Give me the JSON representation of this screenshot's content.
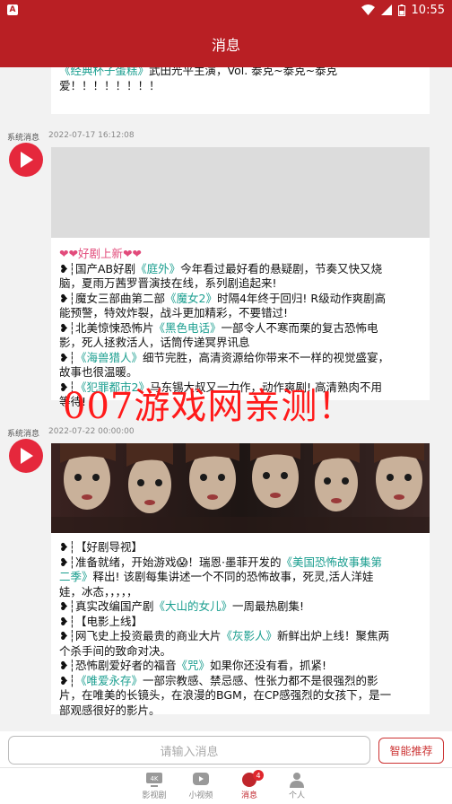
{
  "status_bar": {
    "app_icon": "A",
    "time": "10:55",
    "battery_percent": 50
  },
  "header": {
    "title": "消息"
  },
  "messages": [
    {
      "lines": [
        [
          "《经典杯子蛋糕》",
          "武田光平主演，Vol. 泰克~泰克~泰克"
        ],
        [
          "爱！！！！！！！！"
        ]
      ]
    },
    {
      "source": "系统消息",
      "time": "2022-07-17 16:12:08",
      "lines": [
        [
          "❤❤好剧上新❤❤"
        ],
        [
          "❥┆国产AB好剧",
          "《庭外》",
          "今年看过最好看的悬疑剧，节奏又快又烧"
        ],
        [
          "脑，夏雨万茜罗晋演技在线，系列剧追起来!"
        ],
        [
          "❥┆魔女三部曲第二部",
          "《魔女2》",
          "时隔4年终于回归! R级动作爽剧高"
        ],
        [
          "能预警，特效炸裂，战斗更加精彩，不要错过!"
        ],
        [
          "❥┆北美惊悚恐怖片",
          "《黑色电话》",
          "一部令人不寒而栗的复古恐怖电"
        ],
        [
          "影，死人拯救活人，话筒传递冥界讯息"
        ],
        [
          "❥┆",
          "《海兽猎人》",
          "细节完胜，高清资源给你带来不一样的视觉盛宴，"
        ],
        [
          "故事也很温暖。"
        ],
        [
          "❥┆",
          "《犯罪都市2》",
          "马东锡大叔又一力作，动作爽剧! 高清熟肉不用"
        ],
        [
          "等待!"
        ]
      ]
    },
    {
      "source": "系统消息",
      "time": "2022-07-22 00:00:00",
      "lines": [
        [
          "❥┆【好剧导视】"
        ],
        [
          "❥┆准备就绪，开始游戏😱！瑞恩·墨菲开发的",
          "《美国恐怖故事集第"
        ],
        [
          "二季》",
          "释出! 该剧每集讲述一个不同的恐怖故事，死灵,活人洋娃"
        ],
        [
          "娃，冰态，，，，，"
        ],
        [
          "❥┆真实改编国产剧",
          "《大山的女儿》",
          "一周最热剧集!"
        ],
        [
          "❥┆【电影上线】"
        ],
        [
          "❥┆网飞史上投资最贵的商业大片",
          "《灰影人》",
          "新鲜出炉上线！聚焦两"
        ],
        [
          "个杀手间的致命对决。"
        ],
        [
          "❥┆恐怖剧爱好者的福音",
          "《咒》",
          "如果你还没有看，抓紧!"
        ],
        [
          "❥┆",
          "《唯爱永存》",
          "一部宗教感、禁忌感、性张力都不是很强烈的影"
        ],
        [
          "片，在唯美的长镜头，在浪漫的BGM，在CP感强烈的女孩下，是一"
        ],
        [
          "部观感很好的影片。"
        ]
      ]
    }
  ],
  "watermark": "007游戏网亲测！",
  "input": {
    "placeholder": "请输入消息",
    "smart_button": "智能推荐"
  },
  "tabs": [
    {
      "label": "影视剧",
      "icon": "4k-tv-icon"
    },
    {
      "label": "小视频",
      "icon": "play-video-icon"
    },
    {
      "label": "消息",
      "icon": "message-icon",
      "badge": "4",
      "active": true
    },
    {
      "label": "个人",
      "icon": "person-icon"
    }
  ],
  "colors": {
    "brand": "#b91f24",
    "link": "#1a9e8f",
    "badge": "#e0262c"
  }
}
